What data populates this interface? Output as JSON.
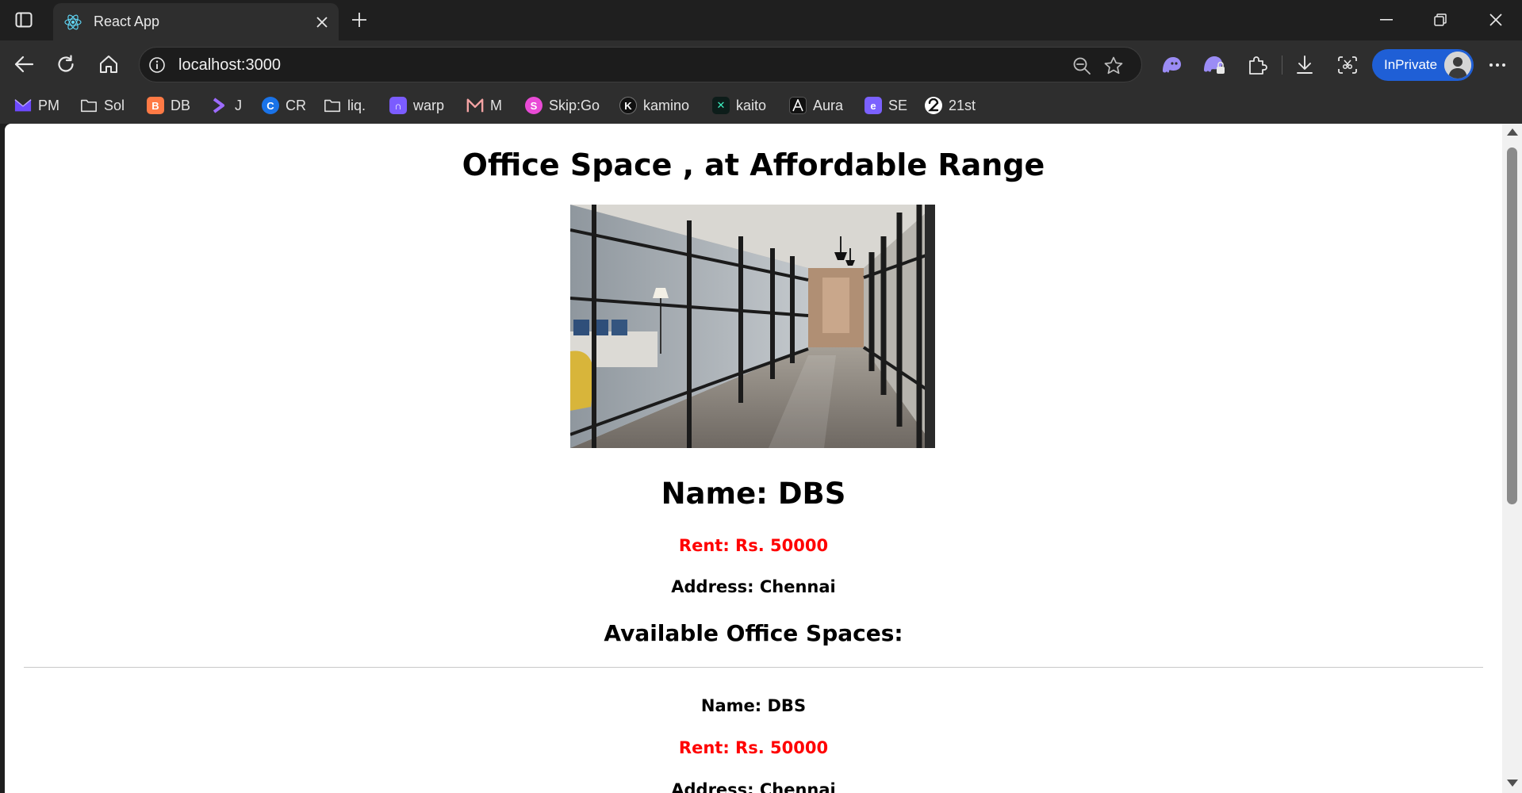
{
  "browser": {
    "tab": {
      "title": "React App",
      "favicon": "react-icon"
    },
    "address_bar": {
      "url": "localhost:3000"
    },
    "profile": {
      "label": "InPrivate"
    },
    "bookmarks": [
      {
        "label": "PM",
        "icon": "proton-mail-icon",
        "color": "#6d4aff"
      },
      {
        "label": "Sol",
        "icon": "folder-icon",
        "color": ""
      },
      {
        "label": "DB",
        "icon": "db-icon",
        "color": "#ff7a45"
      },
      {
        "label": "J",
        "icon": "jupiter-icon",
        "color": "#9d6bff"
      },
      {
        "label": "CR",
        "icon": "cr-icon",
        "color": "#1a73e8"
      },
      {
        "label": "liq.",
        "icon": "folder-icon",
        "color": ""
      },
      {
        "label": "warp",
        "icon": "warp-icon",
        "color": "#7b5cff"
      },
      {
        "label": "M",
        "icon": "m-icon",
        "color": "#f4a3a3"
      },
      {
        "label": "Skip:Go",
        "icon": "skip-icon",
        "color": "#e94bd6"
      },
      {
        "label": "kamino",
        "icon": "kamino-icon",
        "color": "#111111"
      },
      {
        "label": "kaito",
        "icon": "kaito-icon",
        "color": "#0d1d1a"
      },
      {
        "label": "Aura",
        "icon": "aura-icon",
        "color": "#111111"
      },
      {
        "label": "SE",
        "icon": "se-icon",
        "color": "#7b61ff"
      },
      {
        "label": "21st",
        "icon": "21st-icon",
        "color": "#111111"
      }
    ]
  },
  "page": {
    "title": "Office Space , at Affordable Range",
    "hero": {
      "name": "Name: DBS",
      "rent": "Rent: Rs. 50000",
      "address": "Address: Chennai"
    },
    "list_heading": "Available Office Spaces:",
    "items": [
      {
        "name": "Name: DBS",
        "rent": "Rent: Rs. 50000",
        "address": "Address: Chennai"
      }
    ],
    "colors": {
      "rent": "#ff0000",
      "inprivate": "#1f5fd6"
    }
  }
}
